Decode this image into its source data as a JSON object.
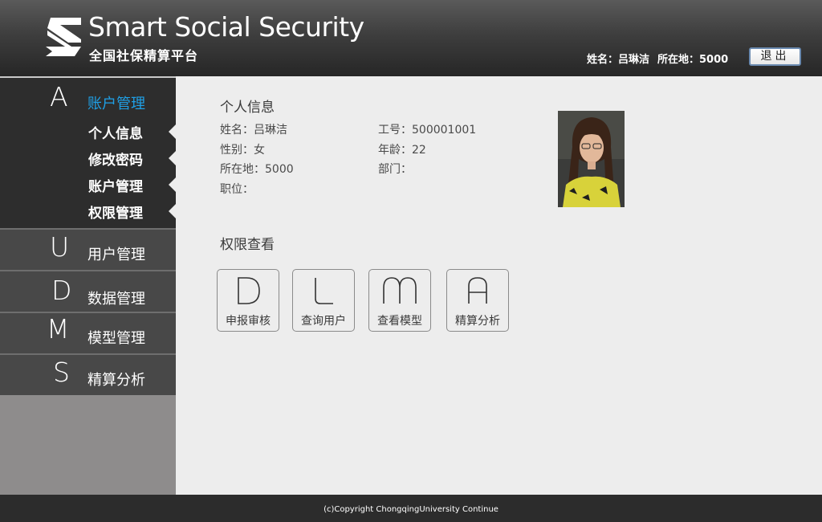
{
  "header": {
    "brand_title": "Smart Social Security",
    "brand_subtitle": "全国社保精算平台",
    "user_name_text": "姓名：吕琳洁",
    "location_text": "所在地：5000",
    "logout_label": "退出"
  },
  "sidebar": {
    "account": {
      "letter": "A",
      "title": "账户管理",
      "items": [
        {
          "label": "个人信息"
        },
        {
          "label": "修改密码"
        },
        {
          "label": "账户管理"
        },
        {
          "label": "权限管理"
        }
      ]
    },
    "sections": [
      {
        "letter": "U",
        "title": "用户管理"
      },
      {
        "letter": "D",
        "title": "数据管理"
      },
      {
        "letter": "M",
        "title": "模型管理"
      },
      {
        "letter": "S",
        "title": "精算分析"
      }
    ]
  },
  "profile": {
    "heading": "个人信息",
    "name": "姓名：吕琳洁",
    "gender": "性别：女",
    "location": "所在地：5000",
    "position": "职位：",
    "employee_id": "工号：500001001",
    "age": "年龄：22",
    "department": "部门："
  },
  "permissions": {
    "heading": "权限查看",
    "tiles": [
      {
        "letter": "D",
        "label": "申报审核"
      },
      {
        "letter": "L",
        "label": "查询用户"
      },
      {
        "letter": "M",
        "label": "查看模型"
      },
      {
        "letter": "A",
        "label": "精算分析"
      }
    ]
  },
  "footer": {
    "copyright": "(c)Copyright ChongqingUniversity Continue"
  },
  "colors": {
    "accent": "#1fa0e6",
    "header_dark": "#262626",
    "sidebar_active": "#2d2d2d",
    "sidebar_item": "#484848",
    "content_bg": "#ededed"
  }
}
